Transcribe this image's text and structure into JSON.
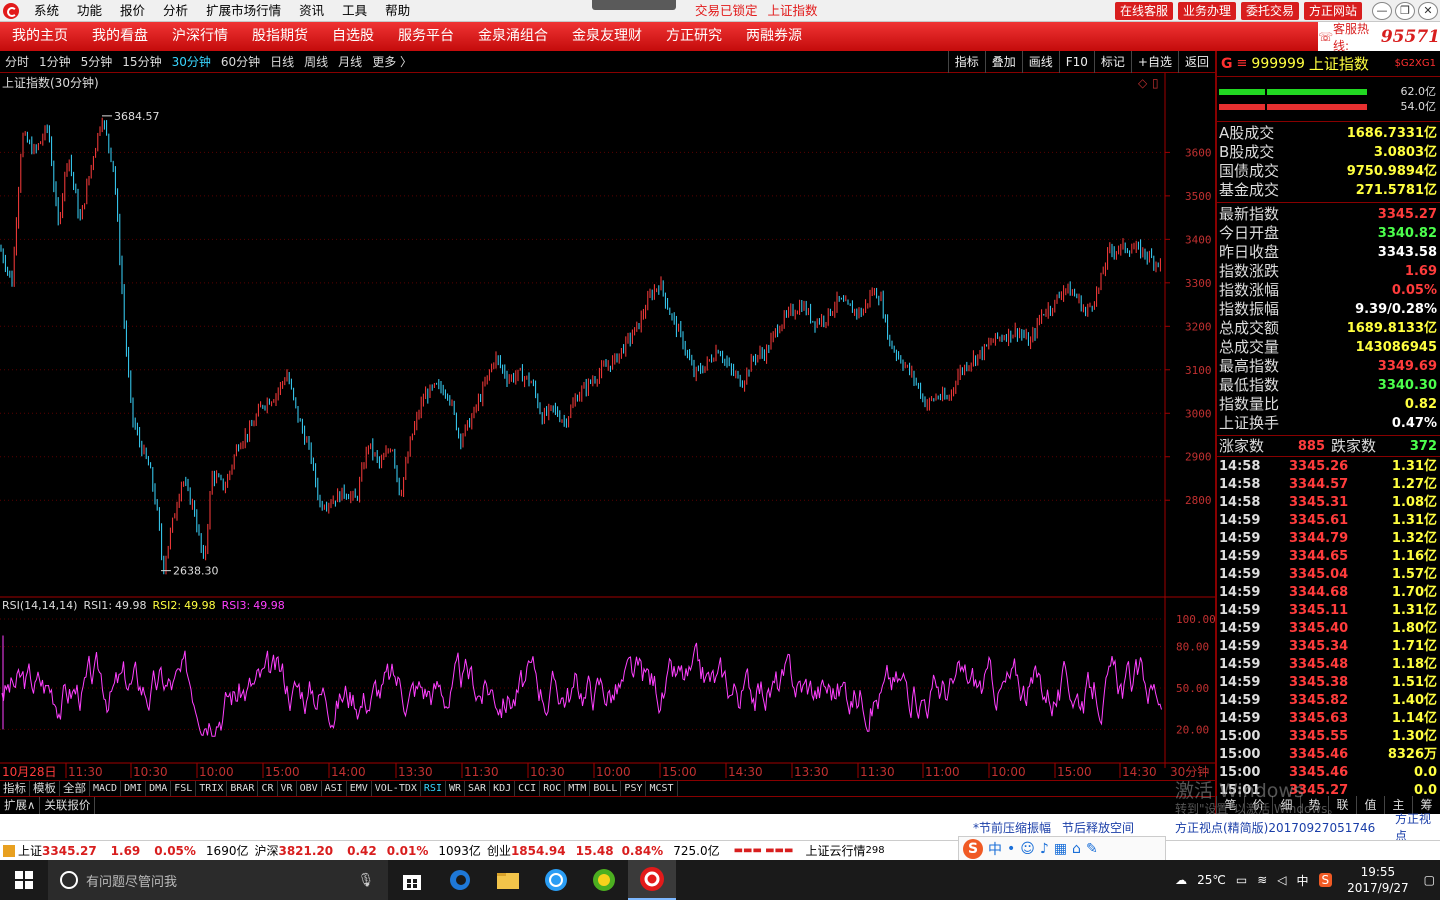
{
  "app": {
    "menu": [
      "系统",
      "功能",
      "报价",
      "分析",
      "扩展市场行情",
      "资讯",
      "工具",
      "帮助"
    ],
    "center": [
      "交易已锁定",
      "上证指数"
    ],
    "buttons": [
      "在线客服",
      "业务办理",
      "委托交易",
      "方正网站"
    ],
    "window_controls": [
      "—",
      "❐",
      "✕"
    ]
  },
  "nav": {
    "items": [
      "我的主页",
      "我的看盘",
      "沪深行情",
      "股指期货",
      "自选股",
      "服务平台",
      "金泉涌组合",
      "金泉友理财",
      "方正研究",
      "两融券源"
    ],
    "hotline_label": "客服热线:",
    "hotline": "95571"
  },
  "periods": {
    "items": [
      "分时",
      "1分钟",
      "5分钟",
      "15分钟",
      "30分钟",
      "60分钟",
      "日线",
      "周线",
      "月线",
      "更多 〉"
    ],
    "active": 4,
    "tools": [
      "指标",
      "叠加",
      "画线",
      "F10",
      "标记",
      "+自选",
      "返回"
    ]
  },
  "chart_data": {
    "type": "candlestick",
    "title": "上证指数(30分钟)",
    "y_ticks": [
      3600,
      3500,
      3400,
      3300,
      3200,
      3100,
      3000,
      2900,
      2800
    ],
    "ylim": [
      2605,
      3732
    ],
    "high_label": "3684.57",
    "low_label": "2638.30",
    "x_labels": [
      "10月28日",
      "11:30",
      "10:30",
      "10:00",
      "15:00",
      "14:00",
      "13:30",
      "11:30",
      "10:30",
      "10:00",
      "15:00",
      "14:30",
      "13:30",
      "11:30",
      "11:00",
      "10:00",
      "15:00",
      "14:30",
      "30分钟"
    ],
    "path": [
      [
        0,
        3380
      ],
      [
        12,
        3300
      ],
      [
        22,
        3640
      ],
      [
        35,
        3600
      ],
      [
        48,
        3660
      ],
      [
        58,
        3430
      ],
      [
        68,
        3600
      ],
      [
        80,
        3440
      ],
      [
        92,
        3580
      ],
      [
        102,
        3684
      ],
      [
        114,
        3560
      ],
      [
        125,
        3180
      ],
      [
        132,
        2990
      ],
      [
        140,
        2930
      ],
      [
        150,
        2870
      ],
      [
        158,
        2760
      ],
      [
        163,
        2638
      ],
      [
        170,
        2720
      ],
      [
        182,
        2850
      ],
      [
        194,
        2780
      ],
      [
        204,
        2650
      ],
      [
        212,
        2860
      ],
      [
        225,
        2830
      ],
      [
        238,
        2930
      ],
      [
        250,
        2960
      ],
      [
        262,
        3020
      ],
      [
        275,
        3040
      ],
      [
        287,
        3090
      ],
      [
        298,
        2990
      ],
      [
        310,
        2910
      ],
      [
        320,
        2790
      ],
      [
        332,
        2800
      ],
      [
        345,
        2820
      ],
      [
        356,
        2800
      ],
      [
        368,
        2930
      ],
      [
        380,
        2880
      ],
      [
        392,
        2930
      ],
      [
        400,
        2810
      ],
      [
        412,
        2950
      ],
      [
        424,
        3040
      ],
      [
        436,
        3060
      ],
      [
        448,
        3050
      ],
      [
        460,
        2940
      ],
      [
        472,
        2990
      ],
      [
        484,
        3060
      ],
      [
        495,
        3130
      ],
      [
        508,
        3080
      ],
      [
        520,
        3090
      ],
      [
        532,
        3070
      ],
      [
        542,
        2990
      ],
      [
        553,
        3010
      ],
      [
        565,
        2980
      ],
      [
        577,
        3040
      ],
      [
        590,
        3070
      ],
      [
        602,
        3100
      ],
      [
        614,
        3120
      ],
      [
        626,
        3160
      ],
      [
        638,
        3200
      ],
      [
        650,
        3270
      ],
      [
        660,
        3300
      ],
      [
        670,
        3230
      ],
      [
        682,
        3170
      ],
      [
        694,
        3090
      ],
      [
        706,
        3110
      ],
      [
        718,
        3150
      ],
      [
        730,
        3100
      ],
      [
        742,
        3070
      ],
      [
        754,
        3130
      ],
      [
        766,
        3140
      ],
      [
        778,
        3200
      ],
      [
        790,
        3230
      ],
      [
        802,
        3250
      ],
      [
        814,
        3210
      ],
      [
        826,
        3220
      ],
      [
        838,
        3260
      ],
      [
        850,
        3240
      ],
      [
        862,
        3230
      ],
      [
        872,
        3280
      ],
      [
        880,
        3270
      ],
      [
        890,
        3160
      ],
      [
        902,
        3120
      ],
      [
        914,
        3080
      ],
      [
        926,
        3020
      ],
      [
        938,
        3040
      ],
      [
        948,
        3030
      ],
      [
        958,
        3090
      ],
      [
        970,
        3120
      ],
      [
        982,
        3140
      ],
      [
        994,
        3170
      ],
      [
        1006,
        3180
      ],
      [
        1018,
        3190
      ],
      [
        1030,
        3160
      ],
      [
        1042,
        3230
      ],
      [
        1054,
        3250
      ],
      [
        1064,
        3290
      ],
      [
        1076,
        3270
      ],
      [
        1086,
        3230
      ],
      [
        1098,
        3280
      ],
      [
        1108,
        3370
      ],
      [
        1120,
        3380
      ],
      [
        1132,
        3380
      ],
      [
        1144,
        3370
      ],
      [
        1154,
        3350
      ],
      [
        1162,
        3345
      ]
    ],
    "rsi": {
      "label": "RSI(14,14,14)",
      "lines": [
        {
          "name": "RSI1",
          "value": "49.98",
          "color": "#dddddd"
        },
        {
          "name": "RSI2",
          "value": "49.98",
          "color": "#ffff40"
        },
        {
          "name": "RSI3",
          "value": "49.98",
          "color": "#ff40ff"
        }
      ],
      "y_ticks": [
        "100.00",
        "80.00",
        "50.00",
        "20.00"
      ]
    }
  },
  "indicators": {
    "items": [
      "指标",
      "模板",
      "全部",
      "MACD",
      "DMI",
      "DMA",
      "FSL",
      "TRIX",
      "BRAR",
      "CR",
      "VR",
      "OBV",
      "ASI",
      "EMV",
      "VOL-TDX",
      "RSI",
      "WR",
      "SAR",
      "KDJ",
      "CCI",
      "ROC",
      "MTM",
      "BOLL",
      "PSY",
      "MCST"
    ],
    "active": "RSI"
  },
  "extbar": [
    "扩展∧",
    "关联报价"
  ],
  "right": {
    "g": "G",
    "code": "999999",
    "name": "上证指数",
    "tag": "$G2XG1",
    "bars": [
      "62.0亿",
      "54.0亿"
    ],
    "sec1": [
      {
        "l": "A股成交",
        "v": "1686.7331亿",
        "c": "#ffff40"
      },
      {
        "l": "B股成交",
        "v": "3.0803亿",
        "c": "#ffff40"
      },
      {
        "l": "国债成交",
        "v": "9750.9894亿",
        "c": "#ffff40"
      },
      {
        "l": "基金成交",
        "v": "271.5781亿",
        "c": "#ffff40"
      }
    ],
    "sec2": [
      {
        "l": "最新指数",
        "v": "3345.27",
        "c": "#ff3c3c"
      },
      {
        "l": "今日开盘",
        "v": "3340.82",
        "c": "#4cff4c"
      },
      {
        "l": "昨日收盘",
        "v": "3343.58",
        "c": "#ffffff"
      },
      {
        "l": "指数涨跌",
        "v": "1.69",
        "c": "#ff3c3c"
      },
      {
        "l": "指数涨幅",
        "v": "0.05%",
        "c": "#ff3c3c"
      },
      {
        "l": "指数振幅",
        "v": "9.39/0.28%",
        "c": "#ffffff"
      },
      {
        "l": "总成交额",
        "v": "1689.8133亿",
        "c": "#ffff40"
      },
      {
        "l": "总成交量",
        "v": "143086945",
        "c": "#ffff40"
      },
      {
        "l": "最高指数",
        "v": "3349.69",
        "c": "#ff3c3c"
      },
      {
        "l": "最低指数",
        "v": "3340.30",
        "c": "#4cff4c"
      },
      {
        "l": "指数量比",
        "v": "0.82",
        "c": "#ffff40"
      },
      {
        "l": "上证换手",
        "v": "0.47%",
        "c": "#ffffff"
      }
    ],
    "updown": {
      "up_label": "涨家数",
      "up": "885",
      "down_label": "跌家数",
      "down": "372"
    },
    "ticks": [
      [
        "14:58",
        "3345.26",
        "1.31亿"
      ],
      [
        "14:58",
        "3344.57",
        "1.27亿"
      ],
      [
        "14:58",
        "3345.31",
        "1.08亿"
      ],
      [
        "14:59",
        "3345.61",
        "1.31亿"
      ],
      [
        "14:59",
        "3344.79",
        "1.32亿"
      ],
      [
        "14:59",
        "3344.65",
        "1.16亿"
      ],
      [
        "14:59",
        "3345.04",
        "1.57亿"
      ],
      [
        "14:59",
        "3344.68",
        "1.70亿"
      ],
      [
        "14:59",
        "3345.11",
        "1.31亿"
      ],
      [
        "14:59",
        "3345.40",
        "1.80亿"
      ],
      [
        "14:59",
        "3345.34",
        "1.71亿"
      ],
      [
        "14:59",
        "3345.48",
        "1.18亿"
      ],
      [
        "14:59",
        "3345.38",
        "1.51亿"
      ],
      [
        "14:59",
        "3345.82",
        "1.40亿"
      ],
      [
        "14:59",
        "3345.63",
        "1.14亿"
      ],
      [
        "15:00",
        "3345.55",
        "1.30亿"
      ],
      [
        "15:00",
        "3345.46",
        "8326万"
      ],
      [
        "15:00",
        "3345.46",
        "0.0"
      ],
      [
        "15:01",
        "3345.27",
        "0.0"
      ]
    ],
    "foot": [
      "笔",
      "价",
      "细",
      "势",
      "联",
      "值",
      "主",
      "筹"
    ]
  },
  "watermark": {
    "l1": "激活 Windows",
    "l2": "转到\"设置\"以激活 Windows。"
  },
  "news": [
    "*节前压缩振幅",
    "节后释放空间",
    "方正视点(精简版)20170927051746",
    "方正视点"
  ],
  "status": {
    "sh_label": "上证",
    "sh": "3345.27",
    "sh_chg": "1.69",
    "sh_pct": "0.05%",
    "sh_amt": "1690亿",
    "hs_label": "沪深",
    "hs": "3821.20",
    "hs_chg": "0.42",
    "hs_pct": "0.01%",
    "hs_amt": "1093亿",
    "cy_label": "创业",
    "cy": "1854.94",
    "cy_chg": "15.48",
    "cy_pct": "0.84%",
    "cy_amt": "725.0亿",
    "cloud": "上证云行情",
    "cloud_n": "298"
  },
  "ime": [
    "中",
    "•",
    "☺",
    "♪",
    "▦",
    "⌂",
    "✎"
  ],
  "taskbar": {
    "search": "有问题尽管问我",
    "temp": "25℃",
    "lang": "中",
    "time": "19:55",
    "date": "2017/9/27"
  }
}
